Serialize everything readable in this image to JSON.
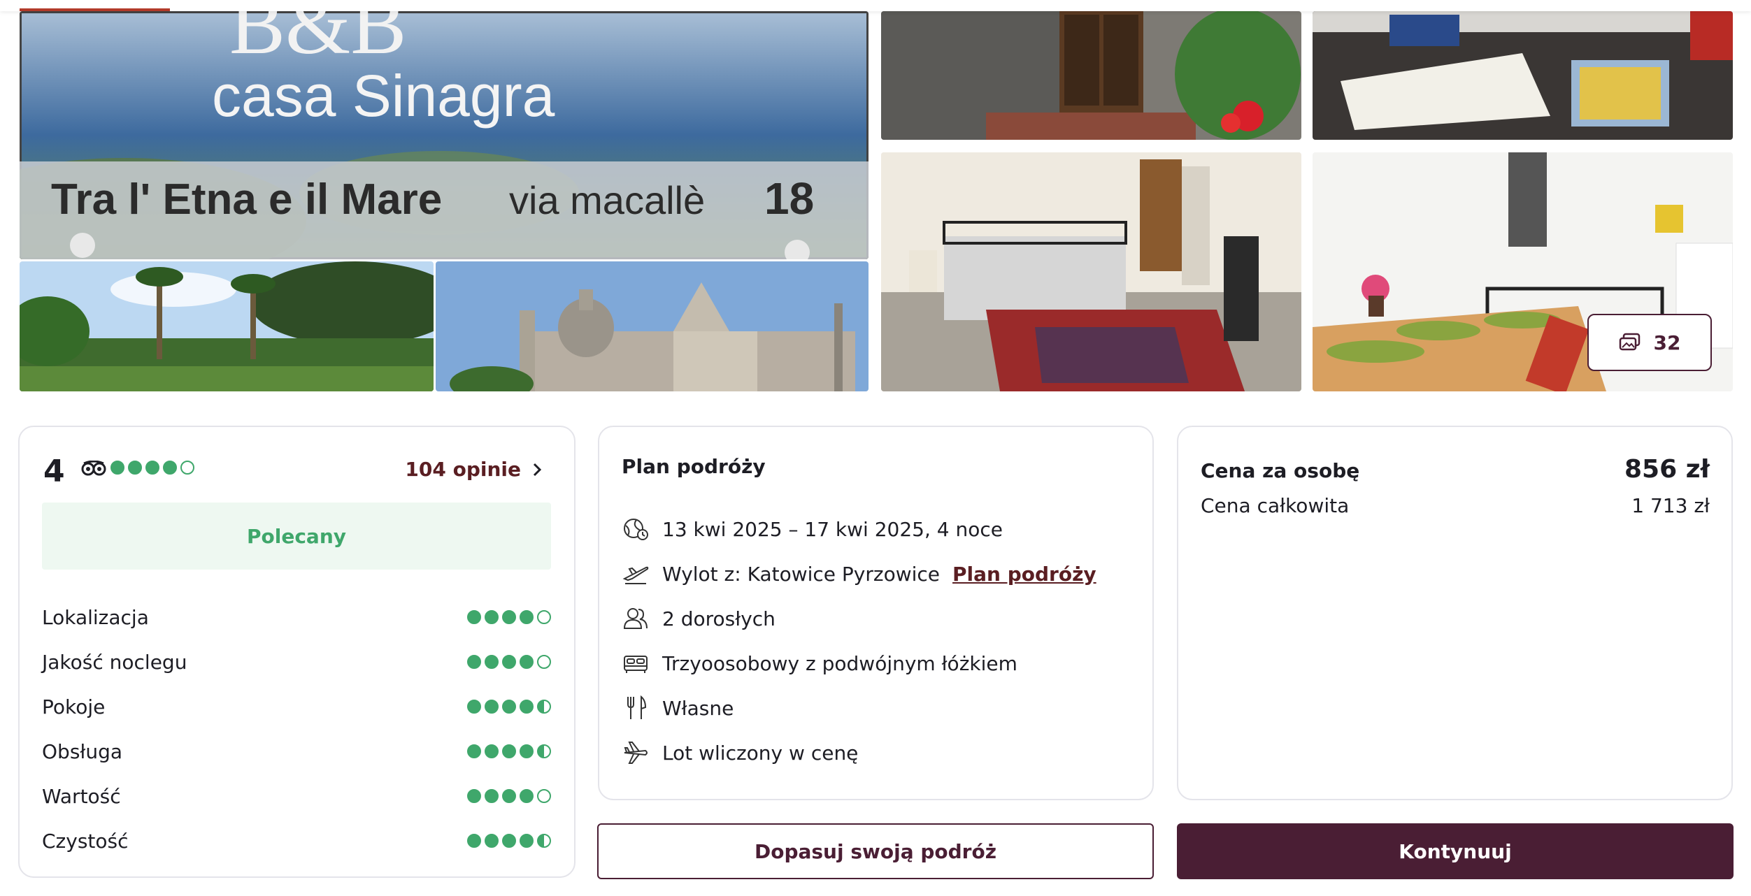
{
  "gallery": {
    "sign_brand": "B&B",
    "sign_name": "casa Sinagra",
    "sign_tagline": "Tra l' Etna e il Mare",
    "sign_address": "via macallè",
    "sign_number": "18",
    "photo_count": "32"
  },
  "rating": {
    "score": "4",
    "score_dots": 4,
    "reviews_label": "104 opinie",
    "badge": "Polecany",
    "categories": [
      {
        "label": "Lokalizacja",
        "value": 4
      },
      {
        "label": "Jakość noclegu",
        "value": 4
      },
      {
        "label": "Pokoje",
        "value": 4.5
      },
      {
        "label": "Obsługa",
        "value": 4.5
      },
      {
        "label": "Wartość",
        "value": 4
      },
      {
        "label": "Czystość",
        "value": 4.5
      }
    ]
  },
  "trip": {
    "title": "Plan podróży",
    "items": [
      {
        "icon": "calendar-globe-icon",
        "text": "13 kwi 2025 – 17 kwi 2025, 4 noce"
      },
      {
        "icon": "plane-takeoff-icon",
        "text": "Wylot z: Katowice Pyrzowice",
        "link": "Plan podróży"
      },
      {
        "icon": "people-icon",
        "text": "2 dorosłych"
      },
      {
        "icon": "bed-icon",
        "text": "Trzyoosobowy z podwójnym łóżkiem"
      },
      {
        "icon": "cutlery-icon",
        "text": "Własne"
      },
      {
        "icon": "plane-icon",
        "text": "Lot wliczony w cenę"
      }
    ]
  },
  "price": {
    "per_person_label": "Cena za osobę",
    "per_person_value": "856 zł",
    "total_label": "Cena całkowita",
    "total_value": "1 713 zł"
  },
  "actions": {
    "customize_label": "Dopasuj swoją podróż",
    "continue_label": "Kontynuuj"
  },
  "colors": {
    "brand": "#4a1e34",
    "rating_green": "#3fa76b",
    "link": "#5a1e22",
    "recommended_bg": "#eef8f1"
  }
}
